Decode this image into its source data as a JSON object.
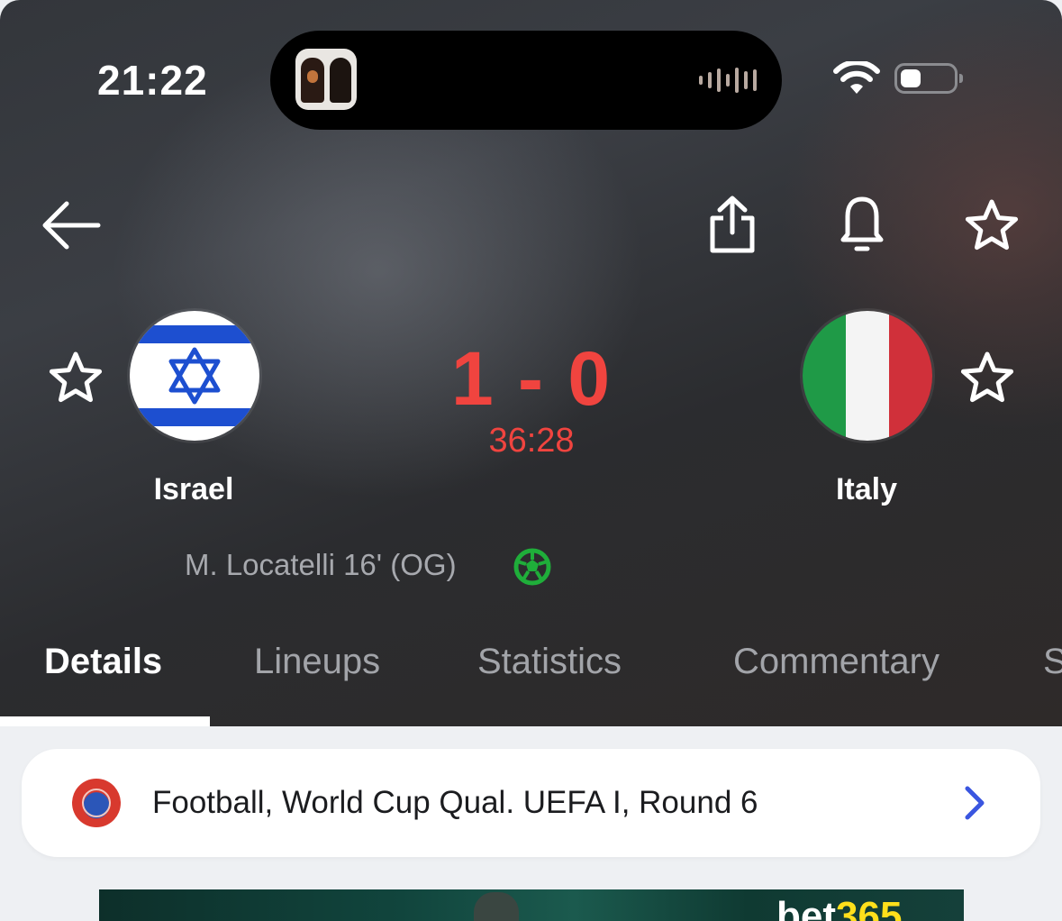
{
  "status_bar": {
    "time": "21:22"
  },
  "match": {
    "home_team": "Israel",
    "away_team": "Italy",
    "score": "1 - 0",
    "clock": "36:28",
    "scorer": "M. Locatelli 16' (OG)"
  },
  "tabs": [
    {
      "label": "Details"
    },
    {
      "label": "Lineups"
    },
    {
      "label": "Statistics"
    },
    {
      "label": "Commentary"
    },
    {
      "label": "S"
    }
  ],
  "competition": {
    "label": "Football, World Cup Qual. UEFA I, Round 6"
  },
  "ad": {
    "brand_part1": "bet",
    "brand_part2": "365"
  },
  "colors": {
    "score_red": "#f0443f",
    "goal_green": "#1fae3a",
    "chevron_blue": "#3a56e0",
    "israel_blue": "#1d4fd0",
    "italy_green": "#1f9a47",
    "italy_red": "#d0303a"
  },
  "icons": {
    "back": "arrow-left-icon",
    "share": "share-icon",
    "notify": "bell-icon",
    "favorite": "star-outline-icon",
    "goal": "football-icon",
    "competition": "uefa-logo",
    "chevron": "chevron-right-icon"
  }
}
